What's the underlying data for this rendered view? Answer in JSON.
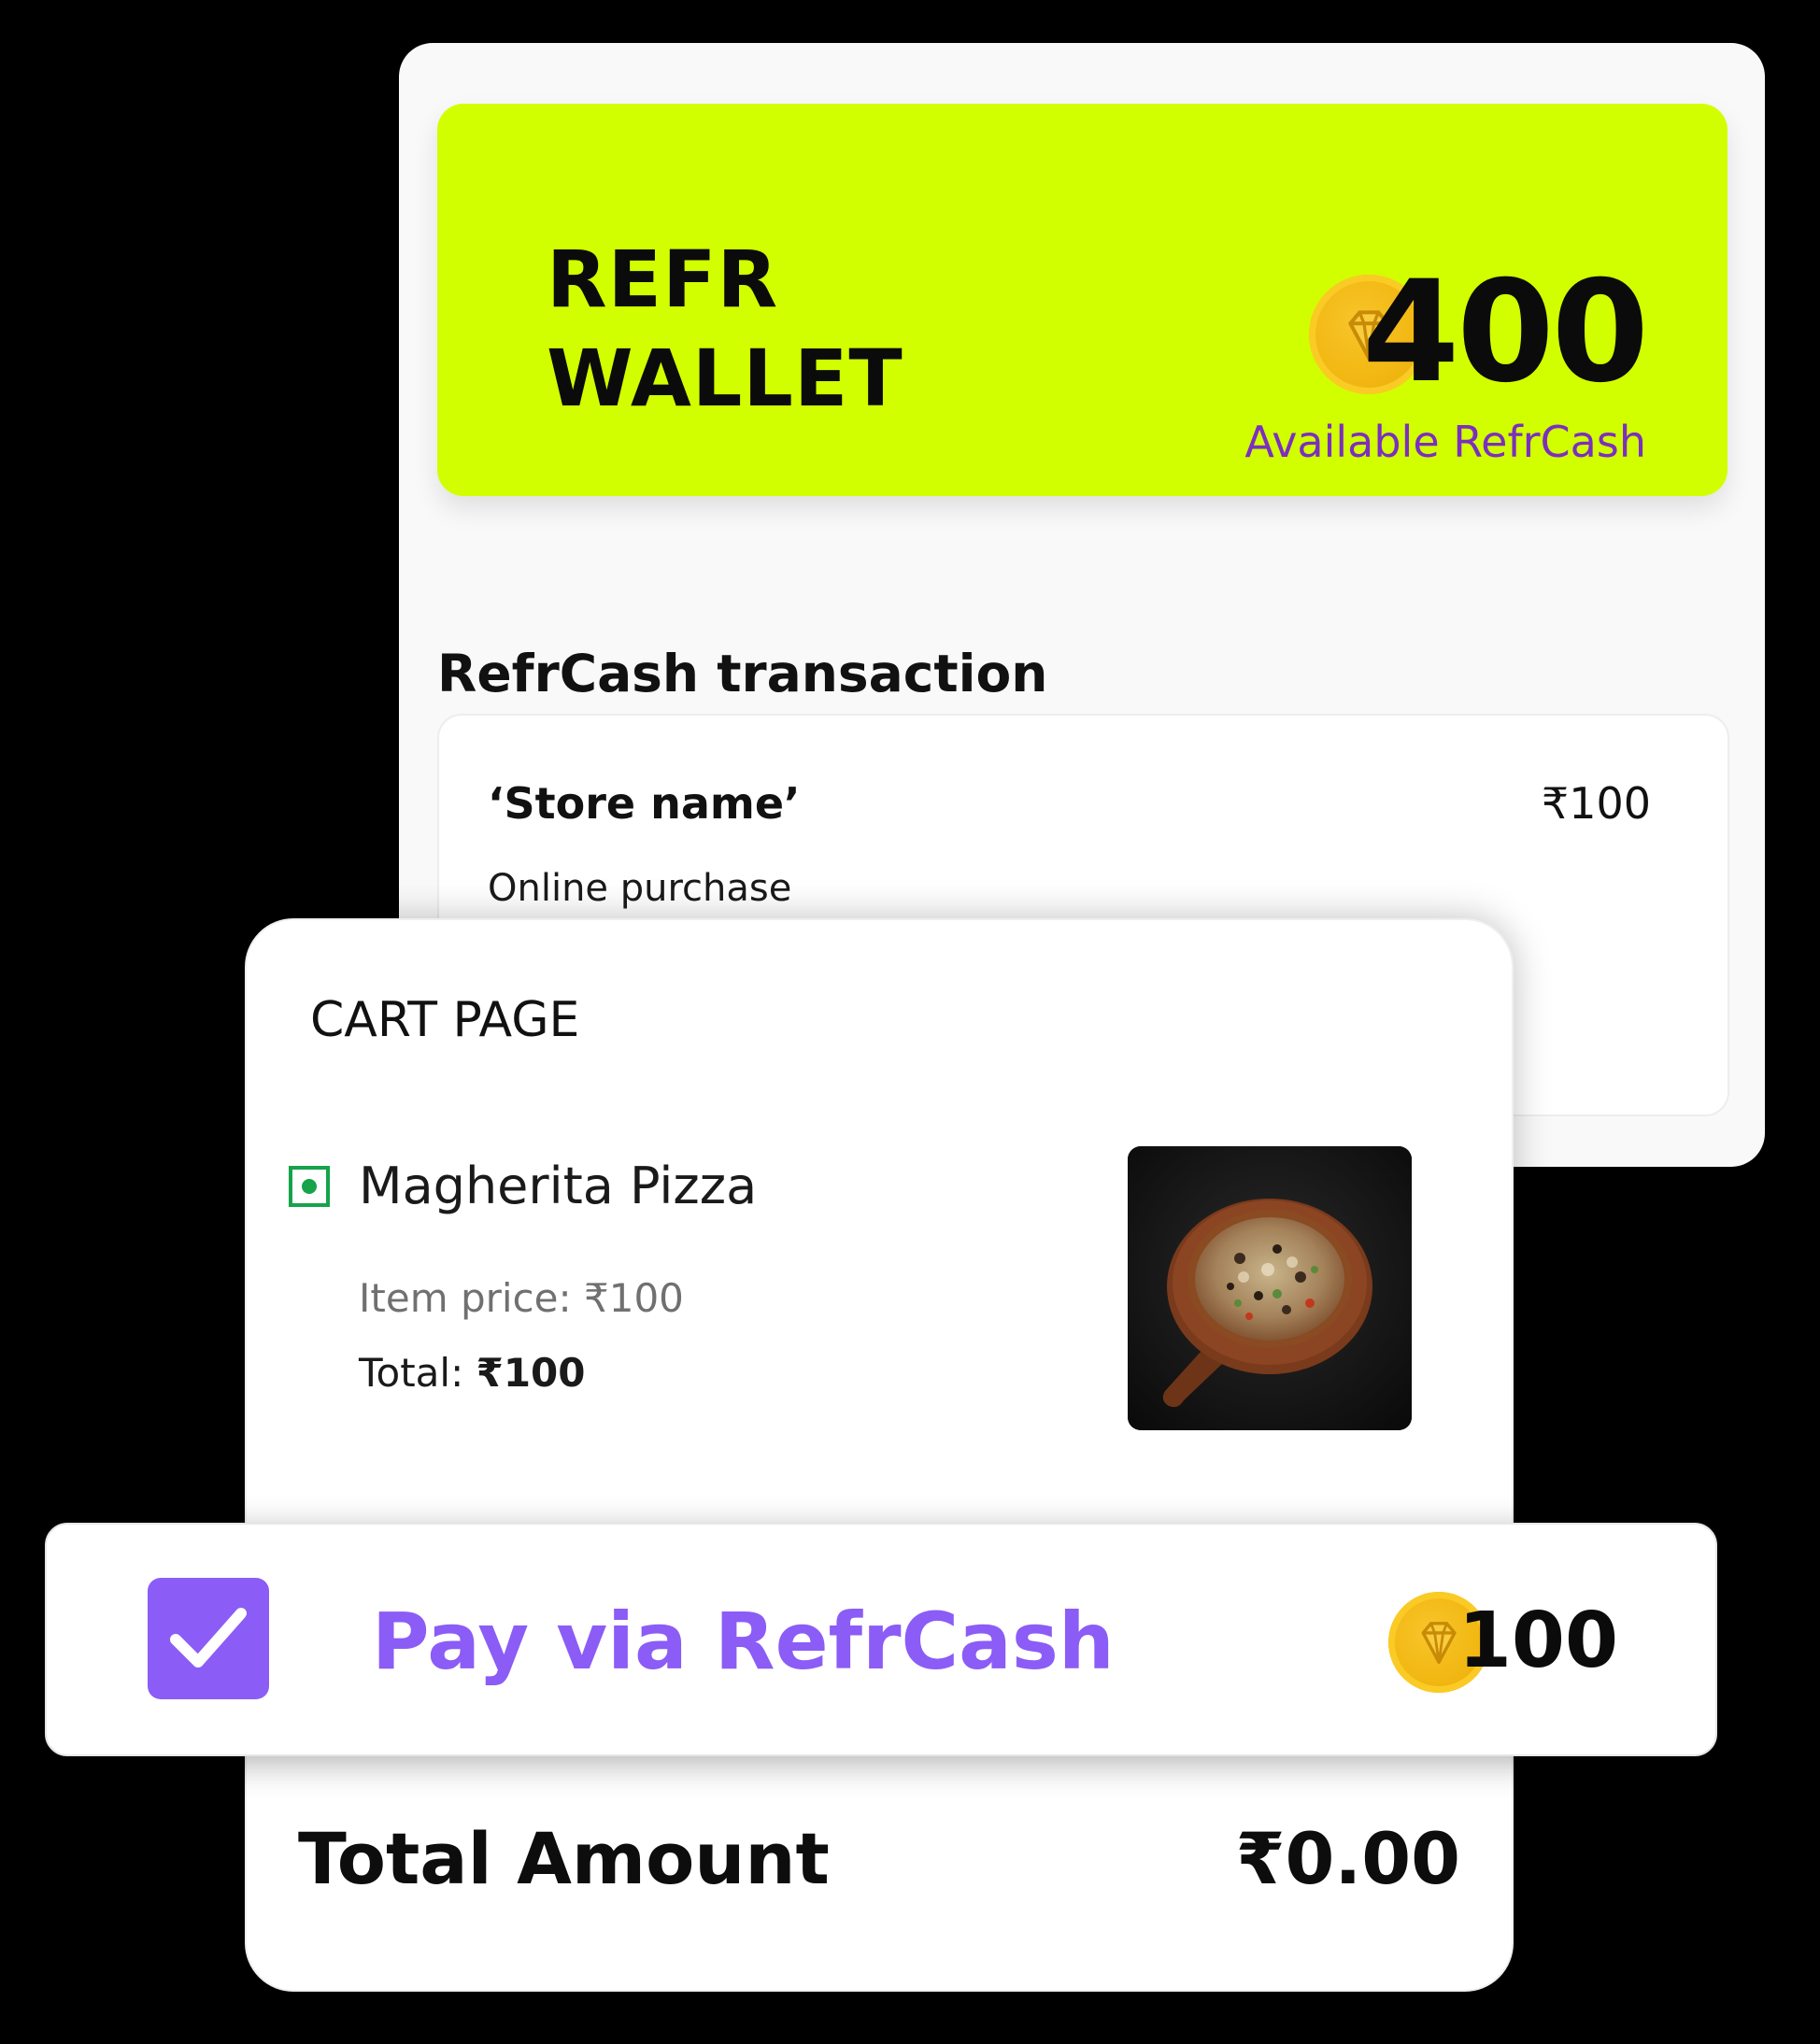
{
  "colors": {
    "page_background": "#000000",
    "wallet_banner": "#d2ff00",
    "accent_purple": "#8b5cf6",
    "available_text": "#7b2fbe",
    "coin_gold": "#f5bd17",
    "veg_green": "#16a34a"
  },
  "wallet": {
    "title_line1": "REFR",
    "title_line2": "WALLET",
    "coin_icon": "diamond-coin-icon",
    "balance": "400",
    "balance_caption": "Available RefrCash"
  },
  "transactions": {
    "heading": "RefrCash transaction",
    "items": [
      {
        "store": "‘Store name’",
        "amount": "₹100",
        "type": "Online purchase"
      }
    ]
  },
  "cart": {
    "title": "CART PAGE",
    "item": {
      "veg_icon": "veg-indicator-icon",
      "name": "Magherita Pizza",
      "price_label": "Item price:",
      "price": "₹100",
      "total_label": "Total:",
      "total": "₹100",
      "image": "pizza-photo"
    },
    "total_amount_label": "Total Amount",
    "total_amount": "₹0.00"
  },
  "pay": {
    "checked": true,
    "check_icon": "checkmark-icon",
    "label": "Pay via RefrCash",
    "coin_icon": "diamond-coin-icon",
    "amount": "100"
  }
}
